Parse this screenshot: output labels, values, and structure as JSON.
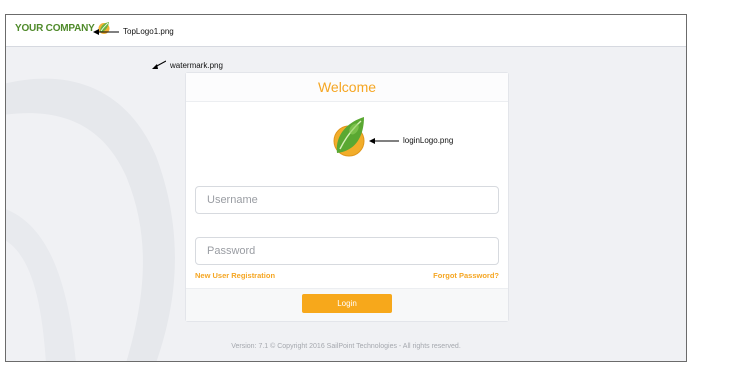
{
  "header": {
    "company_name": "YOUR COMPANY",
    "top_logo_annotation": "TopLogo1.png"
  },
  "watermark": {
    "annotation": "watermark.png"
  },
  "login": {
    "title": "Welcome",
    "logo_annotation": "loginLogo.png",
    "username_placeholder": "Username",
    "password_placeholder": "Password",
    "new_user_link": "New User Registration",
    "forgot_password_link": "Forgot Password?",
    "login_button": "Login"
  },
  "footer": {
    "version_text": "Version: 7.1   © Copyright 2016 SailPoint Technologies - All rights reserved."
  },
  "colors": {
    "accent": "#f5a623",
    "brand_green": "#4f8a2a",
    "background": "#f0f1f4"
  }
}
